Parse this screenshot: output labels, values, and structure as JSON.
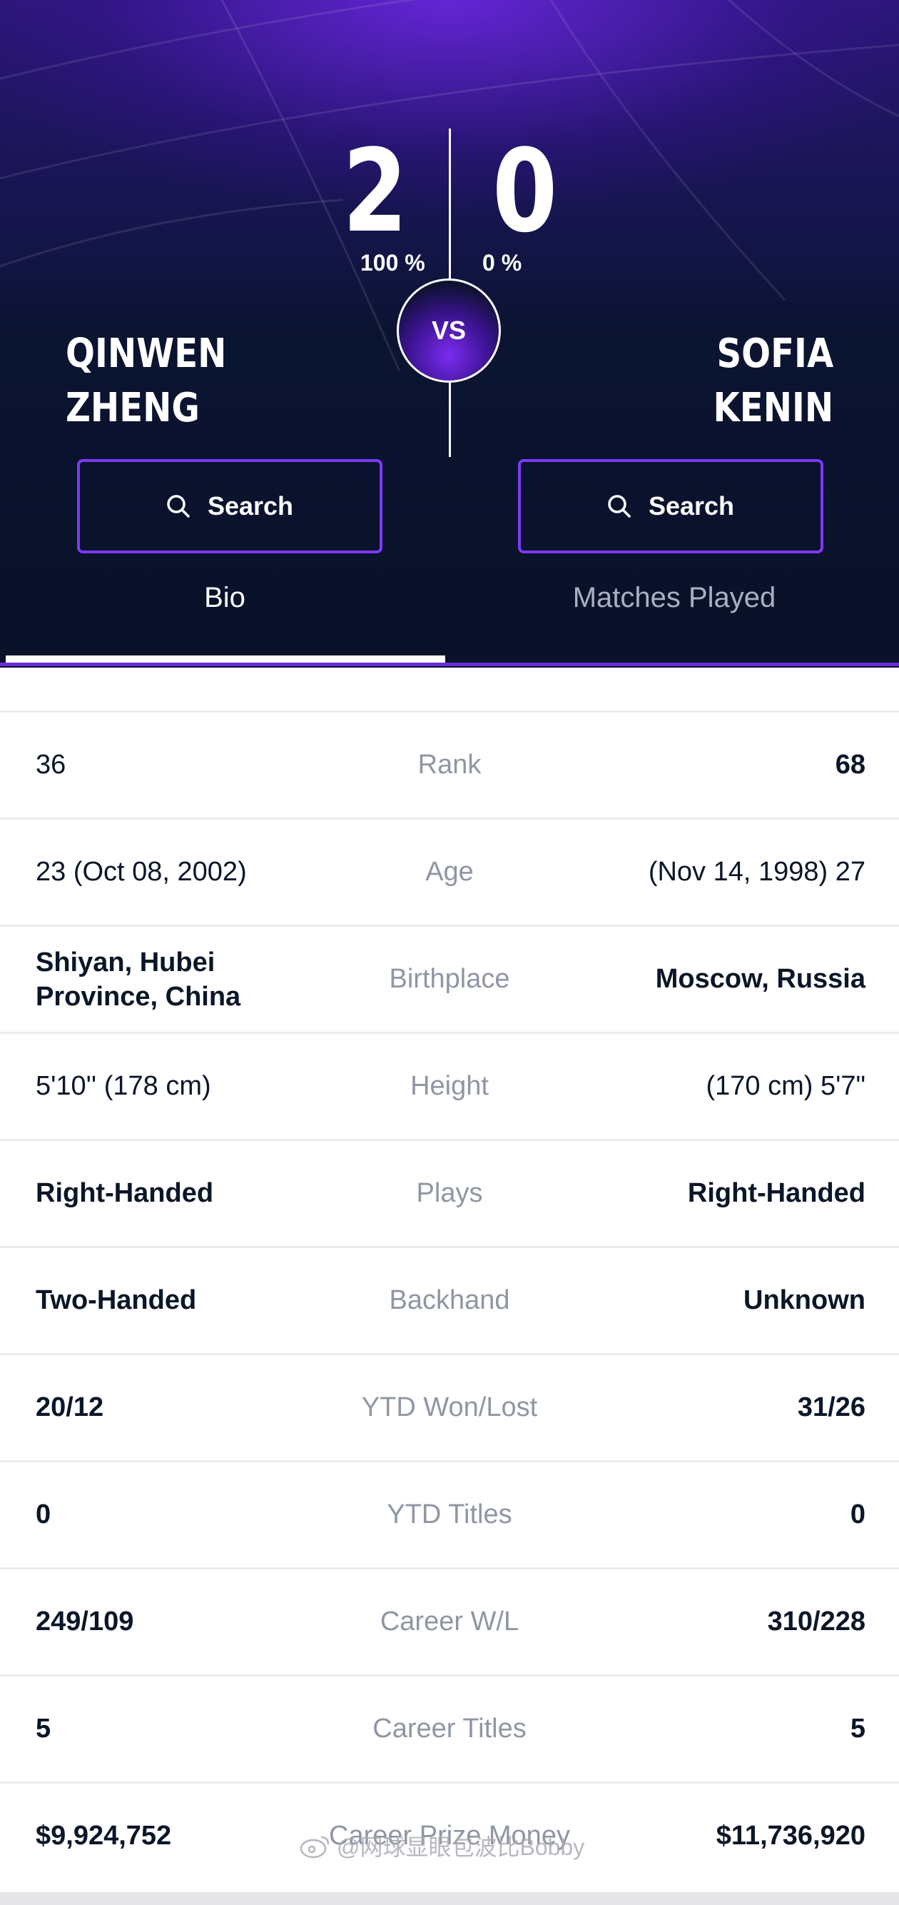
{
  "header": {
    "player_left": {
      "first_name": "QINWEN",
      "last_name": "ZHENG",
      "score": "2",
      "percent": "100 %"
    },
    "player_right": {
      "first_name": "SOFIA",
      "last_name": "KENIN",
      "score": "0",
      "percent": "0 %"
    },
    "vs_label": "VS",
    "search_label": "Search"
  },
  "tabs": [
    {
      "label": "Bio",
      "active": true
    },
    {
      "label": "Matches Played",
      "active": false
    }
  ],
  "rows": [
    {
      "left": "36",
      "label": "Rank",
      "right": "68",
      "left_bold": false,
      "right_bold": true
    },
    {
      "left": "23 (Oct 08, 2002)",
      "label": "Age",
      "right": "(Nov 14, 1998) 27",
      "left_bold": false,
      "right_bold": false
    },
    {
      "left": "Shiyan, Hubei Province, China",
      "label": "Birthplace",
      "right": "Moscow, Russia",
      "left_bold": true,
      "right_bold": true
    },
    {
      "left": "5'10'' (178 cm)",
      "label": "Height",
      "right": "(170 cm) 5'7\"",
      "left_bold": false,
      "right_bold": false
    },
    {
      "left": "Right-Handed",
      "label": "Plays",
      "right": "Right-Handed",
      "left_bold": true,
      "right_bold": true
    },
    {
      "left": "Two-Handed",
      "label": "Backhand",
      "right": "Unknown",
      "left_bold": true,
      "right_bold": true
    },
    {
      "left": "20/12",
      "label": "YTD Won/Lost",
      "right": "31/26",
      "left_bold": true,
      "right_bold": true
    },
    {
      "left": "0",
      "label": "YTD Titles",
      "right": "0",
      "left_bold": true,
      "right_bold": true
    },
    {
      "left": "249/109",
      "label": "Career W/L",
      "right": "310/228",
      "left_bold": true,
      "right_bold": true
    },
    {
      "left": "5",
      "label": "Career Titles",
      "right": "5",
      "left_bold": true,
      "right_bold": true
    },
    {
      "left": "$9,924,752",
      "label": "Career Prize Money",
      "right": "$11,736,920",
      "left_bold": true,
      "right_bold": true
    }
  ],
  "watermark": "@网球显眼包波比Bobby",
  "colors": {
    "accent": "#6a2fd9",
    "button_border": "#7b3af5",
    "label_gray": "#8f96a3",
    "text_dark": "#0b1628"
  },
  "icons": {
    "search": "search-icon",
    "weibo": "weibo-logo-icon"
  }
}
